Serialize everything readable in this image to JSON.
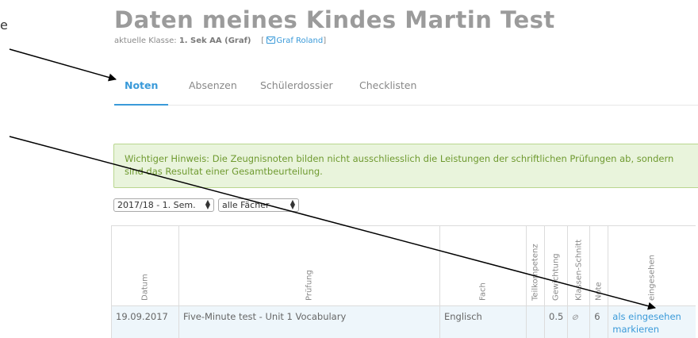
{
  "left_fragment": "e",
  "header": {
    "title": "Daten meines Kindes Martin Test",
    "class_label": "aktuelle Klasse: ",
    "class_value": "1. Sek AA (Graf)",
    "teacher_prefix": "[",
    "teacher_name": "Graf Roland",
    "teacher_suffix": "]"
  },
  "tabs": [
    {
      "label": "Noten",
      "active": true
    },
    {
      "label": "Absenzen",
      "active": false
    },
    {
      "label": "Schülerdossier",
      "active": false
    },
    {
      "label": "Checklisten",
      "active": false
    }
  ],
  "notice": {
    "text": "Wichtiger Hinweis: Die Zeugnisnoten bilden nicht ausschliesslich die Leistungen der schriftlichen Prüfungen ab, sondern sind das Resultat einer Gesamtbeurteilung."
  },
  "filters": {
    "semester_value": "2017/18 - 1. Sem.",
    "subject_value": "alle Fächer"
  },
  "table": {
    "columns": [
      "Datum",
      "Prüfung",
      "Fach",
      "Teilkompetenz",
      "Gewichtung",
      "Klassen-Schnitt",
      "Note",
      "eingesehen"
    ],
    "rows": [
      {
        "datum": "19.09.2017",
        "pruefung": "Five-Minute test - Unit 1 Vocabulary",
        "fach": "Englisch",
        "teilkompetenz": "",
        "gewichtung": "0.5",
        "klassen_schnitt_icon": "eye-slash-icon",
        "note": "6",
        "eingesehen_link_line1": "als eingesehen",
        "eingesehen_link_line2": "markieren"
      }
    ]
  },
  "colors": {
    "accent": "#3a9ad9",
    "title": "#9b9b9b",
    "notice_bg": "#e9f4dc",
    "notice_text": "#6f9a30",
    "row_bg": "#eef6fb"
  }
}
